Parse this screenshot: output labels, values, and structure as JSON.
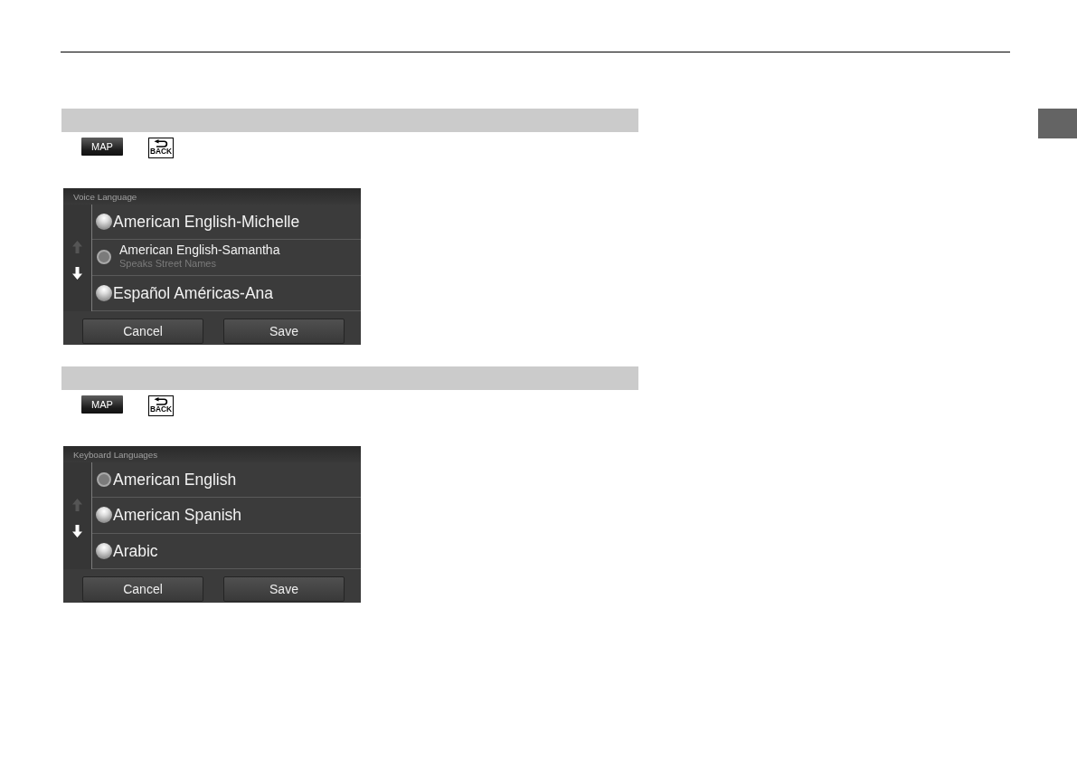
{
  "sections": [
    {
      "steps": [
        {
          "kind": "map",
          "label": "MAP"
        },
        {
          "kind": "back",
          "label": "BACK"
        }
      ],
      "screen": {
        "title": "Voice Language",
        "scroll_arrows": [
          {
            "kind": "up",
            "disabled": true
          },
          {
            "kind": "down",
            "disabled": false
          }
        ],
        "options": [
          {
            "label": "American English-Michelle",
            "selected": false
          },
          {
            "label": "American English-Samantha",
            "sublabel": "Speaks Street Names",
            "selected": true
          },
          {
            "label": "Español Américas-Ana",
            "selected": false
          }
        ],
        "buttons": [
          "Cancel",
          "Save"
        ]
      }
    },
    {
      "steps": [
        {
          "kind": "map",
          "label": "MAP"
        },
        {
          "kind": "back",
          "label": "BACK"
        }
      ],
      "screen": {
        "title": "Keyboard Languages",
        "scroll_arrows": [
          {
            "kind": "up",
            "disabled": true
          },
          {
            "kind": "down",
            "disabled": false
          }
        ],
        "options": [
          {
            "label": "American English",
            "selected": true
          },
          {
            "label": "American Spanish",
            "selected": false
          },
          {
            "label": "Arabic",
            "selected": false
          }
        ],
        "buttons": [
          "Cancel",
          "Save"
        ]
      }
    }
  ]
}
